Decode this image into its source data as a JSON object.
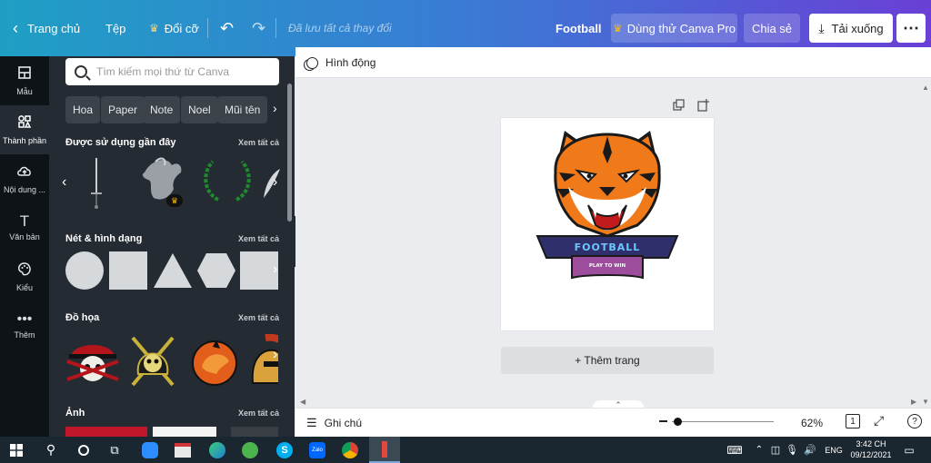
{
  "topbar": {
    "home": "Trang chủ",
    "file": "Tệp",
    "resize": "Đổi cỡ",
    "saved_status": "Đã lưu tất cả thay đổi",
    "design_title": "Football",
    "try_pro": "Dùng thử Canva Pro",
    "share": "Chia sẻ",
    "download": "Tải xuống"
  },
  "rail": [
    {
      "label": "Mẫu",
      "icon": "template-icon"
    },
    {
      "label": "Thành phần",
      "icon": "elements-icon"
    },
    {
      "label": "Nội dung ...",
      "icon": "upload-cloud-icon"
    },
    {
      "label": "Văn bản",
      "icon": "text-icon"
    },
    {
      "label": "Kiểu",
      "icon": "palette-icon"
    },
    {
      "label": "Thêm",
      "icon": "more-icon"
    }
  ],
  "search": {
    "placeholder": "Tìm kiếm mọi thứ từ Canva"
  },
  "chips": [
    "Hoa",
    "Paper",
    "Note",
    "Noel",
    "Mũi tên"
  ],
  "sections": {
    "recent": {
      "title": "Được sử dụng gần đây",
      "see_all": "Xem tất cả"
    },
    "shapes": {
      "title": "Nét & hình dạng",
      "see_all": "Xem tất cả"
    },
    "graphics": {
      "title": "Đồ họa",
      "see_all": "Xem tất cả"
    },
    "photos": {
      "title": "Ảnh",
      "see_all": "Xem tất cả"
    }
  },
  "toolbar": {
    "animate": "Hình động"
  },
  "design": {
    "banner_text": "FOOTBALL",
    "ribbon_text": "PLAY TO WIN"
  },
  "add_page": "+ Thêm trang",
  "footer": {
    "notes": "Ghi chú",
    "zoom": "62%",
    "page_count": "1",
    "zoom_fraction": 0.62
  },
  "taskbar": {
    "lang": "ENG",
    "time": "3:42 CH",
    "date": "09/12/2021",
    "zalo": "Zalo"
  },
  "colors": {
    "accent_start": "#1f9fc4",
    "accent_end": "#6a3fd6",
    "pro_crown": "#f5b70b",
    "tiger_orange": "#f07a1a",
    "banner_navy": "#2e2f6b",
    "ribbon_purple": "#9c4d9c"
  }
}
